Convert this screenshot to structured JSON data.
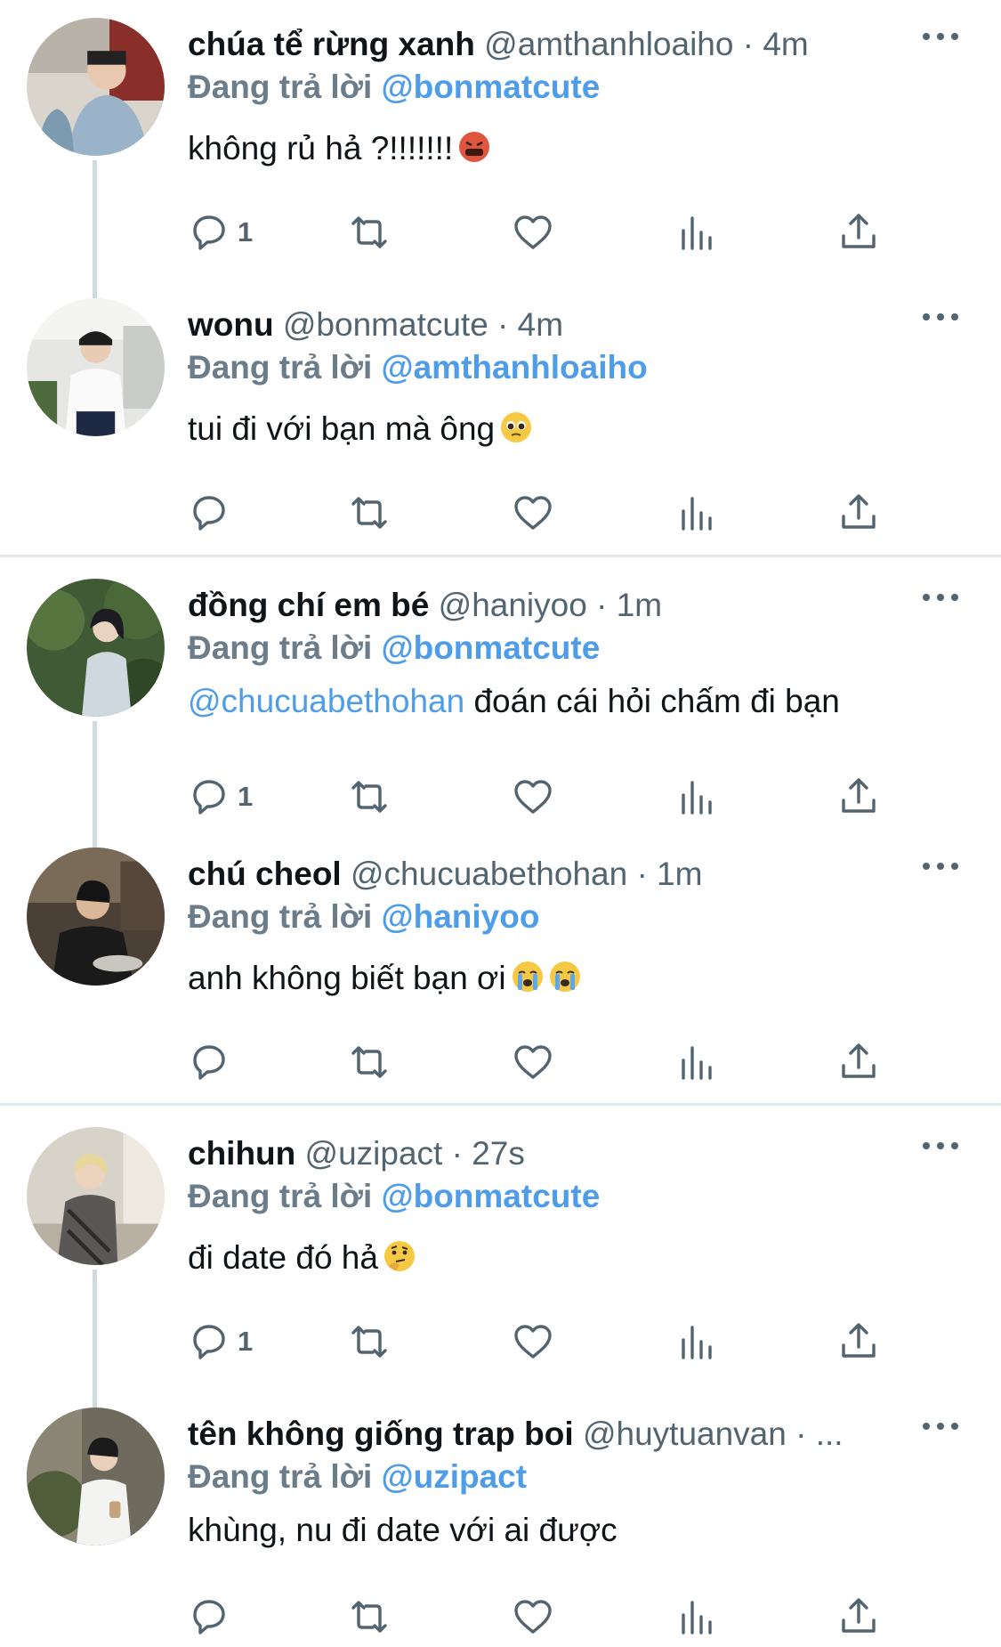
{
  "replying_label": "Đang trả lời",
  "colors": {
    "accent": "#4f9de9",
    "text": "#0f1419",
    "muted": "#536471",
    "thread_line": "#cfd9de"
  },
  "tweets": [
    {
      "name": "chúa tể rừng xanh",
      "meta": "@amthanhloaiho · 4m",
      "reply_to": "@bonmatcute",
      "mention": "",
      "text": "không rủ hả ?!!!!!!!",
      "emoji": "angry-emoji",
      "reply_count": "1"
    },
    {
      "name": "wonu",
      "meta": "@bonmatcute · 4m",
      "reply_to": "@amthanhloaiho",
      "mention": "",
      "text": "tui đi với bạn mà ông",
      "emoji": "pleading-emoji",
      "reply_count": ""
    },
    {
      "name": "đồng chí em bé",
      "meta": "@haniyoo · 1m",
      "reply_to": "@bonmatcute",
      "mention": "@chucuabethohan",
      "text": " đoán cái hỏi chấm đi bạn",
      "emoji": "",
      "reply_count": "1"
    },
    {
      "name": "chú cheol",
      "meta": "@chucuabethohan · 1m",
      "reply_to": "@haniyoo",
      "mention": "",
      "text": "anh không biết bạn ơi",
      "emoji": "crying-emoji",
      "reply_count": ""
    },
    {
      "name": "chihun",
      "meta": "@uzipact · 27s",
      "reply_to": "@bonmatcute",
      "mention": "",
      "text": "đi date đó hả",
      "emoji": "thinking-emoji",
      "reply_count": "1"
    },
    {
      "name": "tên không giống trap boi",
      "meta": "@huytuanvan · ...",
      "reply_to": "@uzipact",
      "mention": "",
      "text": "khùng, nu đi date với ai được",
      "emoji": "",
      "reply_count": ""
    }
  ]
}
